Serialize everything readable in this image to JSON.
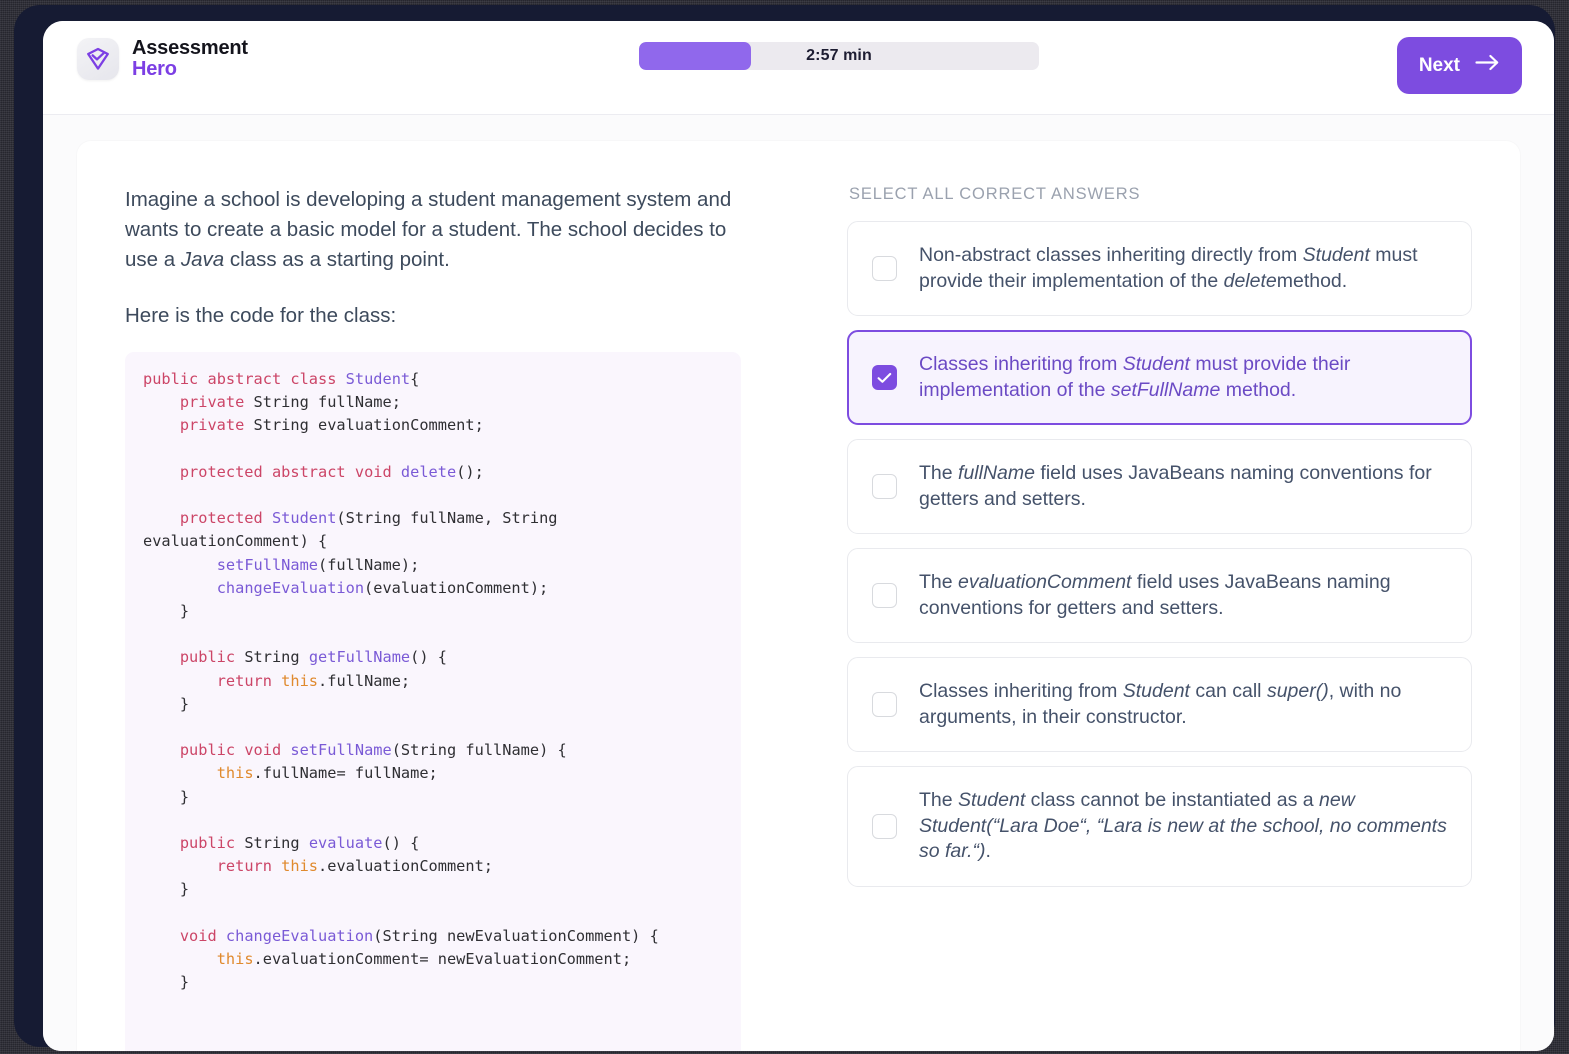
{
  "brand": {
    "line1": "Assessment",
    "line2": "Hero",
    "icon": "shield-check-logo-icon"
  },
  "header": {
    "timer_label": "2:57 min",
    "timer_progress_percent": 28,
    "next_label": "Next",
    "next_icon": "arrow-right-icon"
  },
  "colors": {
    "accent": "#7d4ce0",
    "accent_light": "#9068ec",
    "selected_bg": "#f7f3fe",
    "code_bg": "#faf6fd",
    "text": "#45526a"
  },
  "question": {
    "paragraph_1_a": "Imagine a school is developing a student management system and wants to create a basic model for a student. The school decides to use a ",
    "paragraph_1_em": "Java",
    "paragraph_1_b": " class as a starting point.",
    "paragraph_2": "Here is the code for the class:",
    "code": "public abstract class Student{\n    private String fullName;\n    private String evaluationComment;\n\n    protected abstract void delete();\n\n    protected Student(String fullName, String evaluationComment) {\n        setFullName(fullName);\n        changeEvaluation(evaluationComment);\n    }\n\n    public String getFullName() {\n        return this.fullName;\n    }\n\n    public void setFullName(String fullName) {\n        this.fullName= fullName;\n    }\n\n    public String evaluate() {\n        return this.evaluationComment;\n    }\n\n    void changeEvaluation(String newEvaluationComment) {\n        this.evaluationComment= newEvaluationComment;\n    }"
  },
  "answers": {
    "heading": "SELECT ALL CORRECT ANSWERS",
    "options": [
      {
        "id": "option-1",
        "checked": false,
        "parts": [
          {
            "text": "Non-abstract classes inheriting directly from ",
            "em": false
          },
          {
            "text": "Student",
            "em": true
          },
          {
            "text": " must provide their implementation of the ",
            "em": false
          },
          {
            "text": "delete",
            "em": true
          },
          {
            "text": "method.",
            "em": false
          }
        ]
      },
      {
        "id": "option-2",
        "checked": true,
        "parts": [
          {
            "text": "Classes inheriting from ",
            "em": false
          },
          {
            "text": "Student",
            "em": true
          },
          {
            "text": " must provide their implementation of the ",
            "em": false
          },
          {
            "text": "setFullName",
            "em": true
          },
          {
            "text": " method.",
            "em": false
          }
        ]
      },
      {
        "id": "option-3",
        "checked": false,
        "parts": [
          {
            "text": "The ",
            "em": false
          },
          {
            "text": "fullName",
            "em": true
          },
          {
            "text": " field uses JavaBeans naming conventions for getters and setters.",
            "em": false
          }
        ]
      },
      {
        "id": "option-4",
        "checked": false,
        "parts": [
          {
            "text": "The ",
            "em": false
          },
          {
            "text": "evaluationComment",
            "em": true
          },
          {
            "text": " field uses JavaBeans naming conventions for getters and setters.",
            "em": false
          }
        ]
      },
      {
        "id": "option-5",
        "checked": false,
        "parts": [
          {
            "text": "Classes inheriting from ",
            "em": false
          },
          {
            "text": "Student",
            "em": true
          },
          {
            "text": " can call ",
            "em": false
          },
          {
            "text": "super()",
            "em": true
          },
          {
            "text": ", with no arguments, in their constructor.",
            "em": false
          }
        ]
      },
      {
        "id": "option-6",
        "checked": false,
        "parts": [
          {
            "text": "The ",
            "em": false
          },
          {
            "text": "Student",
            "em": true
          },
          {
            "text": " class cannot be instantiated as a ",
            "em": false
          },
          {
            "text": "new Student(“Lara Doe“, “Lara is new at the school, no comments so far.“)",
            "em": true
          },
          {
            "text": ".",
            "em": false
          }
        ]
      }
    ]
  }
}
